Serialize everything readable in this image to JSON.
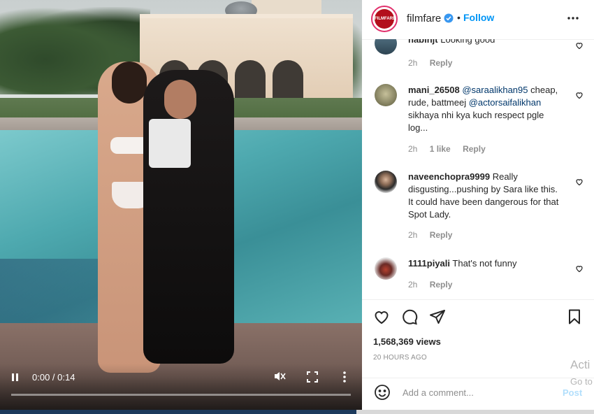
{
  "video": {
    "time": "0:00 / 0:14",
    "progress_fraction": 0.0
  },
  "header": {
    "username": "filmfare",
    "logo_text": "FILMFARE",
    "separator": "•",
    "follow_label": "Follow"
  },
  "comments": [
    {
      "username": "nabinjt",
      "text": "Looking good",
      "time": "2h",
      "likes": "",
      "reply": "Reply"
    },
    {
      "username": "mani_26508",
      "mention1": "@saraalikhan95",
      "text_a": " cheap, rude, battmeej ",
      "mention2": "@actorsaifalikhan",
      "text_b": " sikhaya nhi kya kuch respect pgle log...",
      "time": "2h",
      "likes": "1 like",
      "reply": "Reply"
    },
    {
      "username": "naveenchopra9999",
      "text": "Really disgusting...pushing by Sara like this. It could have been dangerous for that Spot Lady.",
      "time": "2h",
      "likes": "",
      "reply": "Reply"
    },
    {
      "username": "1111piyali",
      "text": "That's not funny",
      "time": "2h",
      "likes": "",
      "reply": "Reply"
    }
  ],
  "stats": {
    "views": "1,568,369 views",
    "posted": "20 HOURS AGO"
  },
  "add_comment": {
    "placeholder": "Add a comment...",
    "post_label": "Post"
  },
  "watermark": {
    "line1": "Acti",
    "line2": "Go to"
  },
  "colors": {
    "follow": "#0095f6",
    "brand_logo": "#b3101c",
    "post_disabled": "#b2dffc"
  },
  "icons": [
    "pause-icon",
    "mute-icon",
    "fullscreen-icon",
    "more-vertical-icon",
    "verified-badge-icon",
    "more-horizontal-icon",
    "heart-icon",
    "comment-icon",
    "share-icon",
    "bookmark-icon",
    "emoji-icon"
  ]
}
